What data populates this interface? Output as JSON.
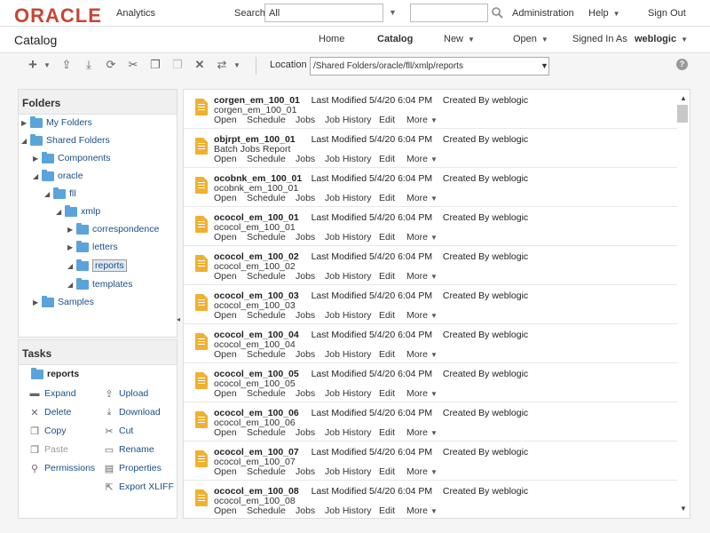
{
  "brand": {
    "logo": "ORACLE",
    "product": "Analytics"
  },
  "topbar": {
    "search_label": "Search",
    "search_scope": "All",
    "search_value": "",
    "administration": "Administration",
    "help": "Help",
    "signout": "Sign Out"
  },
  "header": {
    "title": "Catalog",
    "home": "Home",
    "catalog": "Catalog",
    "new": "New",
    "open": "Open",
    "signed_in_as": "Signed In As",
    "user": "weblogic"
  },
  "toolbar": {
    "location_label": "Location",
    "location_value": "/Shared Folders/oracle/fll/xmlp/reports"
  },
  "folders": {
    "title": "Folders",
    "tree": [
      {
        "label": "My Folders",
        "state": "collapsed"
      },
      {
        "label": "Shared Folders",
        "state": "expanded"
      },
      {
        "label": "Components",
        "state": "collapsed"
      },
      {
        "label": "oracle",
        "state": "expanded"
      },
      {
        "label": "fll",
        "state": "expanded"
      },
      {
        "label": "xmlp",
        "state": "expanded"
      },
      {
        "label": "correspondence",
        "state": "collapsed"
      },
      {
        "label": "letters",
        "state": "collapsed"
      },
      {
        "label": "reports",
        "state": "expanded",
        "selected": true
      },
      {
        "label": "templates",
        "state": "expanded"
      },
      {
        "label": "Samples",
        "state": "collapsed"
      }
    ]
  },
  "tasks": {
    "title": "Tasks",
    "current": "reports",
    "items": [
      {
        "label": "Expand",
        "icon": "expand-folder-icon"
      },
      {
        "label": "Upload",
        "icon": "upload-icon"
      },
      {
        "label": "Delete",
        "icon": "delete-x-icon"
      },
      {
        "label": "Download",
        "icon": "download-icon"
      },
      {
        "label": "Copy",
        "icon": "copy-icon"
      },
      {
        "label": "Cut",
        "icon": "scissors-icon"
      },
      {
        "label": "Paste",
        "icon": "paste-icon",
        "disabled": true
      },
      {
        "label": "Rename",
        "icon": "rename-icon"
      },
      {
        "label": "Permissions",
        "icon": "key-icon"
      },
      {
        "label": "Properties",
        "icon": "properties-icon"
      },
      {
        "label": "Export XLIFF",
        "icon": "export-icon"
      }
    ]
  },
  "list": {
    "modified_label": "Last Modified",
    "created_label": "Created By",
    "actions": [
      "Open",
      "Schedule",
      "Jobs",
      "Job History",
      "Edit",
      "More"
    ],
    "items": [
      {
        "name": "corgen_em_100_01",
        "desc": "corgen_em_100_01",
        "modified": "5/4/20 6:04 PM",
        "created_by": "weblogic"
      },
      {
        "name": "objrpt_em_100_01",
        "desc": "Batch Jobs Report",
        "modified": "5/4/20 6:04 PM",
        "created_by": "weblogic"
      },
      {
        "name": "ocobnk_em_100_01",
        "desc": "ocobnk_em_100_01",
        "modified": "5/4/20 6:04 PM",
        "created_by": "weblogic"
      },
      {
        "name": "ococol_em_100_01",
        "desc": "ococol_em_100_01",
        "modified": "5/4/20 6:04 PM",
        "created_by": "weblogic"
      },
      {
        "name": "ococol_em_100_02",
        "desc": "ococol_em_100_02",
        "modified": "5/4/20 6:04 PM",
        "created_by": "weblogic"
      },
      {
        "name": "ococol_em_100_03",
        "desc": "ococol_em_100_03",
        "modified": "5/4/20 6:04 PM",
        "created_by": "weblogic"
      },
      {
        "name": "ococol_em_100_04",
        "desc": "ococol_em_100_04",
        "modified": "5/4/20 6:04 PM",
        "created_by": "weblogic"
      },
      {
        "name": "ococol_em_100_05",
        "desc": "ococol_em_100_05",
        "modified": "5/4/20 6:04 PM",
        "created_by": "weblogic"
      },
      {
        "name": "ococol_em_100_06",
        "desc": "ococol_em_100_06",
        "modified": "5/4/20 6:04 PM",
        "created_by": "weblogic"
      },
      {
        "name": "ococol_em_100_07",
        "desc": "ococol_em_100_07",
        "modified": "5/4/20 6:04 PM",
        "created_by": "weblogic"
      },
      {
        "name": "ococol_em_100_08",
        "desc": "ococol_em_100_08",
        "modified": "5/4/20 6:04 PM",
        "created_by": "weblogic"
      }
    ]
  }
}
